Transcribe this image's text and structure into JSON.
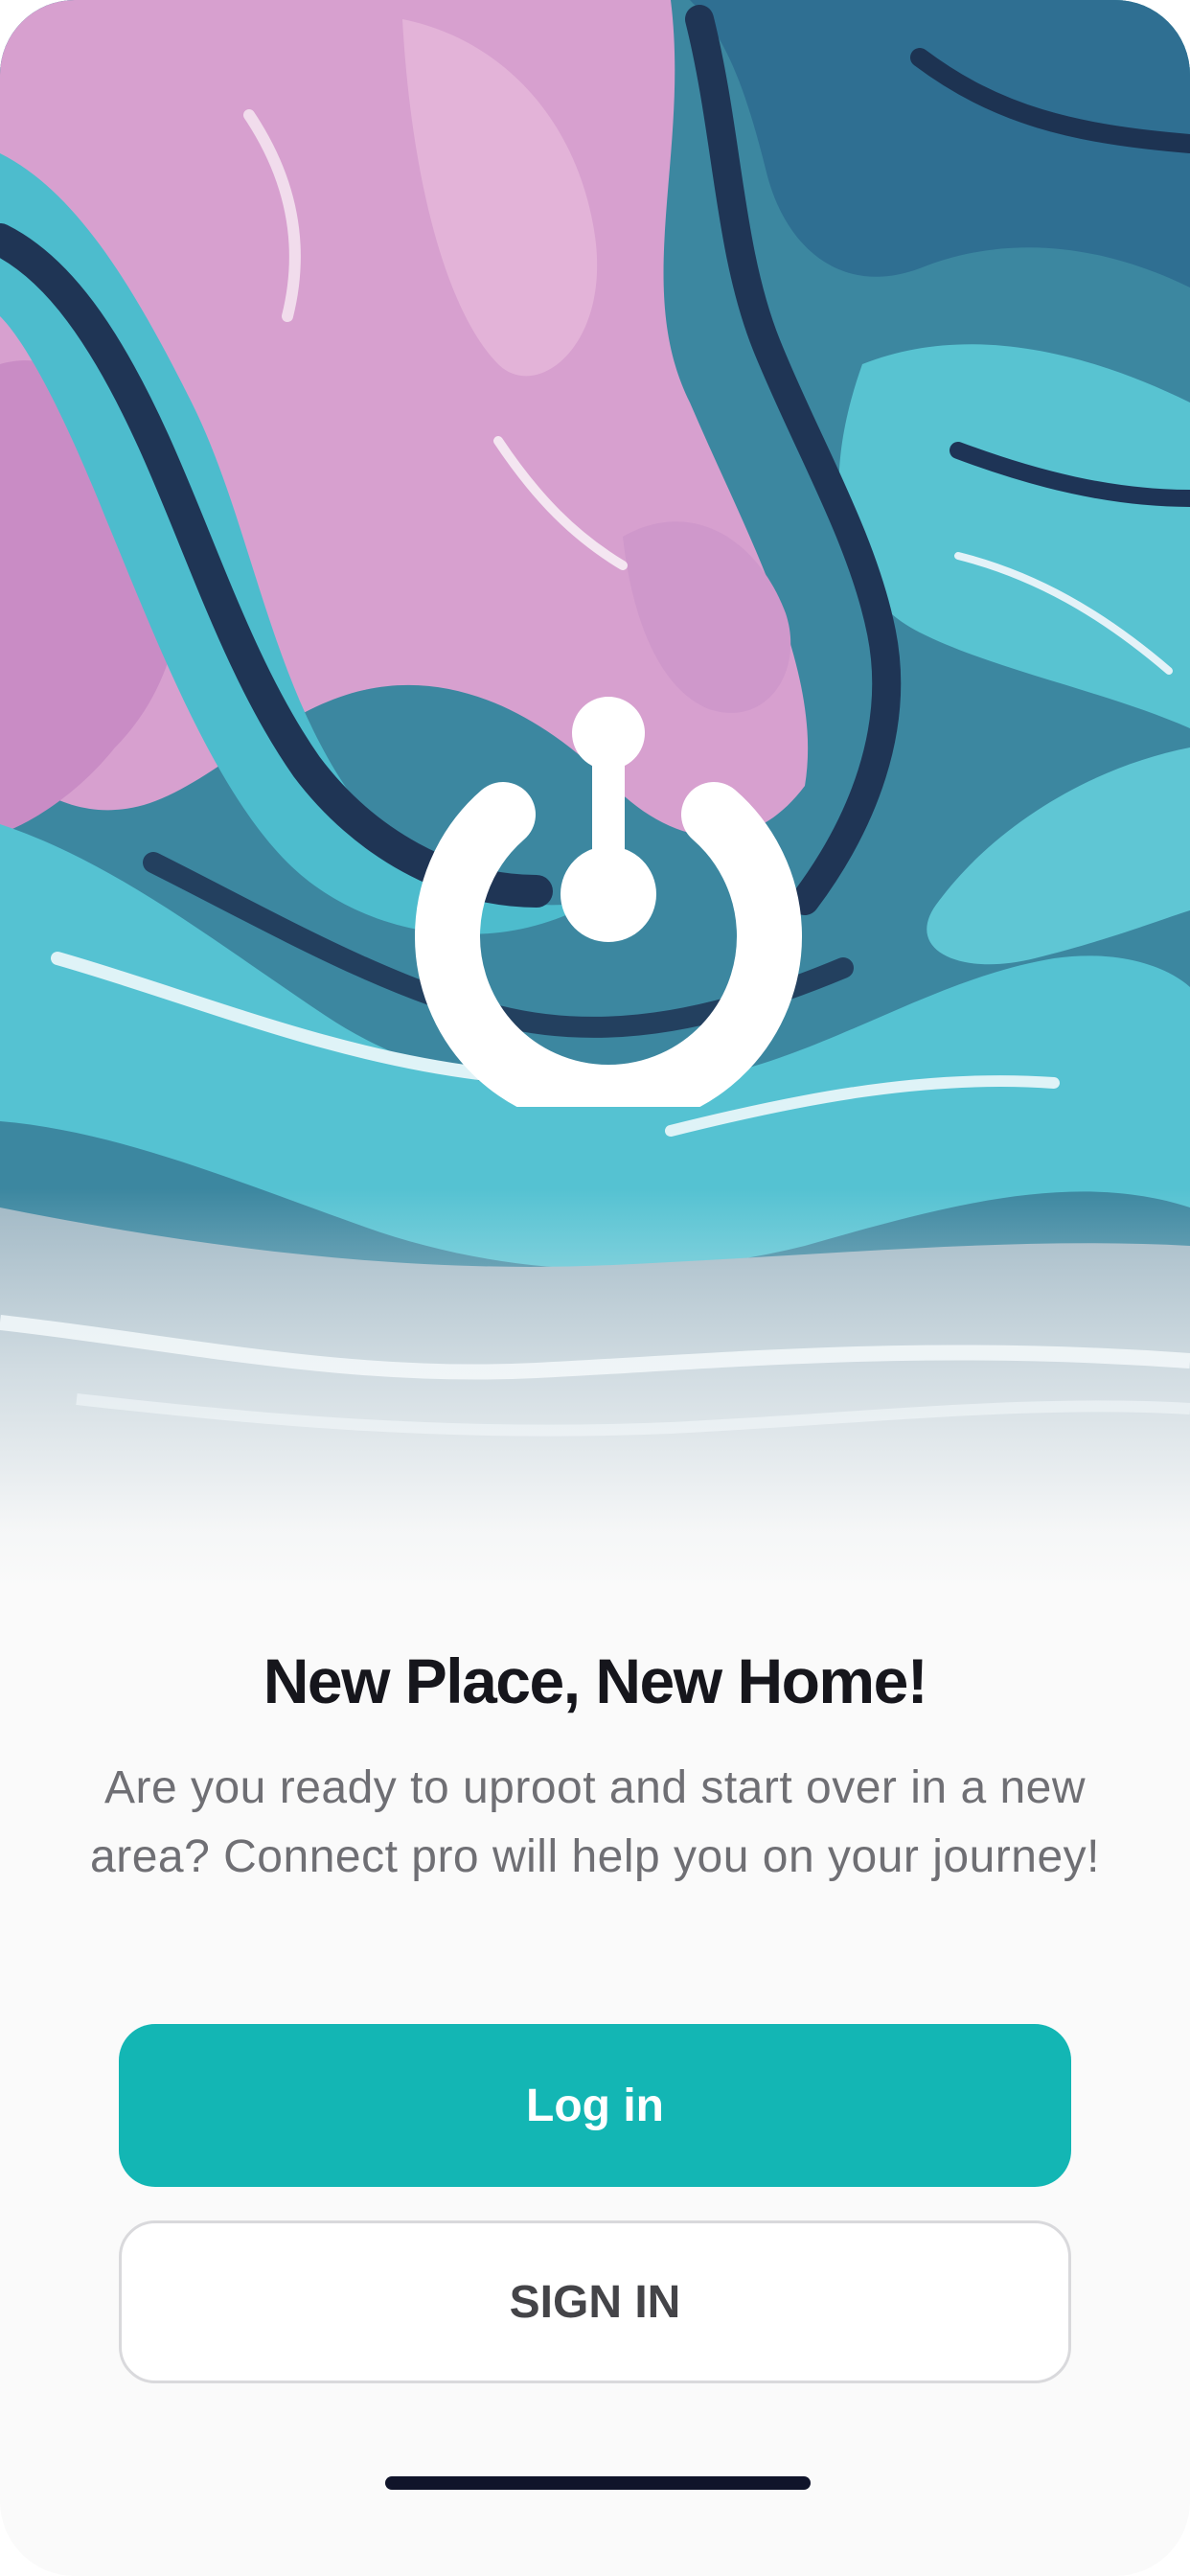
{
  "onboarding": {
    "title": "New Place, New Home!",
    "description": "Are you ready to uproot and start over in a new area? Connect pro will help you on your journey!",
    "login_label": "Log in",
    "signin_label": "SIGN IN"
  },
  "icons": {
    "logo": "power-logo-icon",
    "hero": "marble-background-image"
  },
  "colors": {
    "accent": "#13b6b4",
    "title": "#16161c",
    "body": "#6f6f74",
    "outline": "#d9d9dc",
    "hero_pink": "#d7a0cf",
    "hero_teal": "#4dbccd",
    "hero_navy": "#1f3555"
  }
}
